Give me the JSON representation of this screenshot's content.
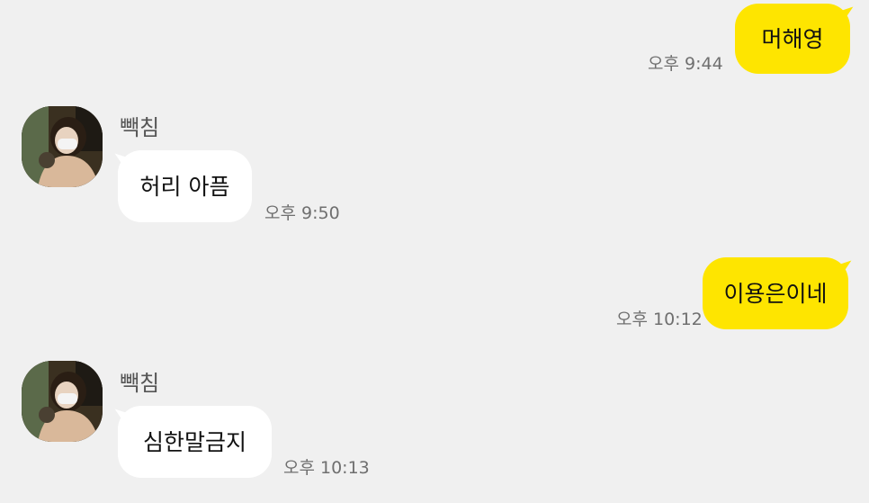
{
  "messages": [
    {
      "direction": "out",
      "text": "머해영",
      "time": "오후 9:44"
    },
    {
      "direction": "in",
      "sender": "빽침",
      "text": "허리 아픔",
      "time": "오후 9:50",
      "avatar": "profile-photo"
    },
    {
      "direction": "out",
      "text": "이용은이네",
      "time": "오후 10:12"
    },
    {
      "direction": "in",
      "sender": "빽침",
      "text": "심한말금지",
      "time": "오후 10:13",
      "avatar": "profile-photo"
    }
  ],
  "colors": {
    "background": "#f0f0f0",
    "outgoing_bubble": "#fee500",
    "incoming_bubble": "#ffffff",
    "timestamp": "#6f6f6f",
    "sender_name": "#555555"
  }
}
